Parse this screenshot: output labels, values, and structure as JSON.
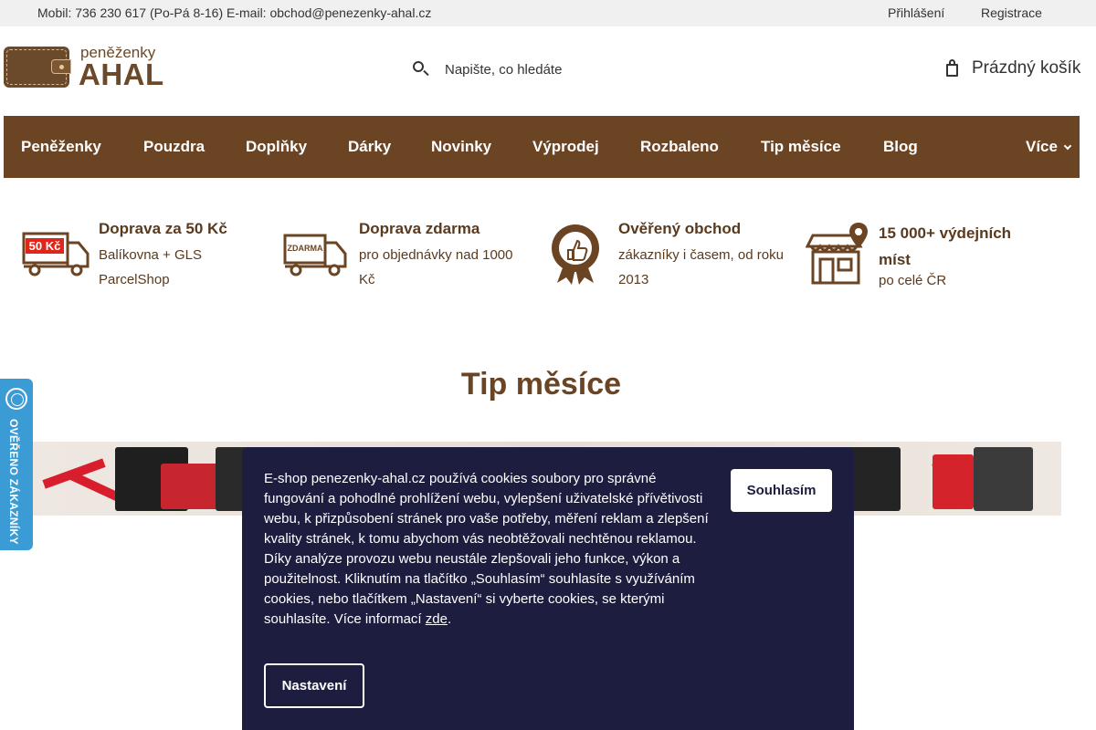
{
  "topbar": {
    "contact": "Mobil: 736 230 617 (Po-Pá 8-16) E-mail: obchod@penezenky-ahal.cz",
    "login": "Přihlášení",
    "register": "Registrace"
  },
  "logo": {
    "small": "peněženky",
    "big": "AHAL"
  },
  "search": {
    "placeholder": "Napište, co hledáte",
    "icon": "search-icon"
  },
  "cart": {
    "label": "Prázdný košík",
    "icon": "cart-icon"
  },
  "nav": {
    "items": [
      "Peněženky",
      "Pouzdra",
      "Doplňky",
      "Dárky",
      "Novinky",
      "Výprodej",
      "Rozbaleno",
      "Tip měsíce",
      "Blog"
    ],
    "more": "Více"
  },
  "benefits": [
    {
      "title": "Doprava za 50 Kč",
      "desc": "Balíkovna + GLS ParcelShop",
      "icon": "truck-50-icon",
      "icon_text": "50 Kč"
    },
    {
      "title": "Doprava zdarma",
      "desc": "pro objednávky nad 1000 Kč",
      "icon": "truck-free-icon",
      "icon_text": "ZDARMA"
    },
    {
      "title": "Ověřený obchod",
      "desc": "zákazníky i časem, od roku 2013",
      "icon": "award-icon"
    },
    {
      "title": "15 000+ výdejních míst",
      "desc": "po celé ČR",
      "icon": "store-location-icon"
    }
  ],
  "section": {
    "title": "Tip měsíce"
  },
  "side_badge": {
    "label": "OVĚŘENO ZÁKAZNÍKY"
  },
  "cookie": {
    "message": "E-shop penezenky-ahal.cz používá cookies soubory pro správné fungování a pohodlné prohlížení webu, vylepšení uživatelské přívětivosti webu, k přizpůsobení stránek pro vaše potřeby, měření reklam a zlepšení kvality stránek, k tomu abychom vás neobtěžovali nechtěnou reklamou. Díky analýze provozu webu neustále zlepšovali jeho funkce, výkon a použitelnost. Kliknutím na tlačítko „Souhlasím“ souhlasíte s využíváním cookies, nebo tlačítkem „Nastavení“ si vyberte cookies, se kterými souhlasíte. Více informací ",
    "link": "zde",
    "end": ".",
    "agree": "Souhlasím",
    "settings": "Nastavení"
  },
  "colors": {
    "brand": "#6b4424",
    "cookie_bg": "#1d1d3f",
    "badge": "#3a9bd5"
  }
}
